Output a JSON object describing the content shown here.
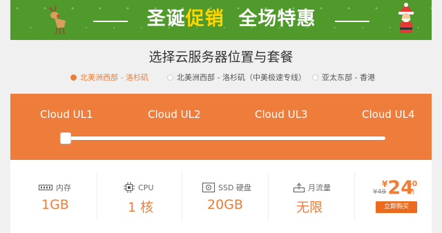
{
  "banner": {
    "title_part1": "圣诞",
    "title_highlight": "促销",
    "title_part2": "全场特惠"
  },
  "section_title": "选择云服务器位置与套餐",
  "regions": [
    {
      "label": "北美洲西部 - 洛杉矶",
      "selected": true
    },
    {
      "label": "北美洲西部 - 洛杉矶（中美极速专线）",
      "selected": false
    },
    {
      "label": "亚太东部 - 香港",
      "selected": false
    }
  ],
  "plans": [
    "Cloud UL1",
    "Cloud UL2",
    "Cloud UL3",
    "Cloud UL4"
  ],
  "slider": {
    "selected_index": 0
  },
  "specs": {
    "memory": {
      "label": "内存",
      "value": "1GB"
    },
    "cpu": {
      "label": "CPU",
      "value": "1 核"
    },
    "ssd": {
      "label": "SSD 硬盘",
      "value": "20GB"
    },
    "traffic": {
      "label": "月流量",
      "value": "无限"
    }
  },
  "price": {
    "old": "¥49",
    "currency": "¥",
    "integer": "24",
    "decimal": "50",
    "unit": "/月",
    "buy_label": "立即购买"
  },
  "colors": {
    "accent": "#ee7d3b",
    "banner_bg": "#4f9a2a",
    "banner_highlight": "#ffd600"
  }
}
